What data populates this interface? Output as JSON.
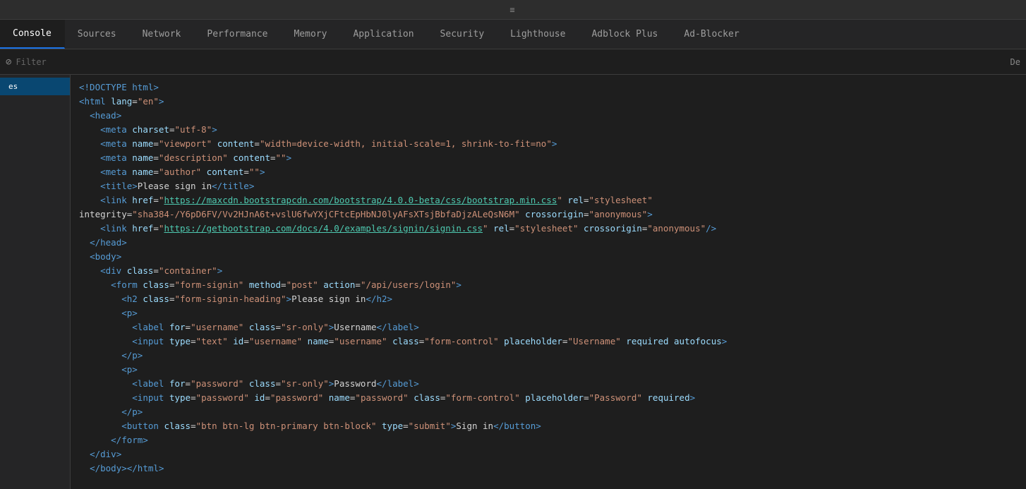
{
  "topBar": {
    "dragHandle": "≡"
  },
  "tabs": [
    {
      "id": "console",
      "label": "Console",
      "active": true
    },
    {
      "id": "sources",
      "label": "Sources",
      "active": false
    },
    {
      "id": "network",
      "label": "Network",
      "active": false
    },
    {
      "id": "performance",
      "label": "Performance",
      "active": false
    },
    {
      "id": "memory",
      "label": "Memory",
      "active": false
    },
    {
      "id": "application",
      "label": "Application",
      "active": false
    },
    {
      "id": "security",
      "label": "Security",
      "active": false
    },
    {
      "id": "lighthouse",
      "label": "Lighthouse",
      "active": false
    },
    {
      "id": "adblock-plus",
      "label": "Adblock Plus",
      "active": false
    },
    {
      "id": "ad-blocker",
      "label": "Ad-Blocker",
      "active": false
    }
  ],
  "filterBar": {
    "placeholder": "Filter",
    "rightLabel": "De"
  },
  "sidebar": {
    "items": [
      {
        "label": "es",
        "active": true
      }
    ]
  },
  "codeLines": [
    {
      "indent": 0,
      "html": "&lt;!DOCTYPE html&gt;"
    },
    {
      "indent": 0,
      "html": "&lt;html lang=\"en\"&gt;"
    },
    {
      "indent": 1,
      "html": "  &lt;head&gt;"
    },
    {
      "indent": 2,
      "html": "    &lt;meta charset=\"utf-8\"&gt;"
    },
    {
      "indent": 2,
      "html": "    &lt;meta name=\"viewport\" content=\"width=device-width, initial-scale=1, shrink-to-fit=no\"&gt;"
    },
    {
      "indent": 2,
      "html": "    &lt;meta name=\"description\" content=\"\"&gt;"
    },
    {
      "indent": 2,
      "html": "    &lt;meta name=\"author\" content=\"\"&gt;"
    },
    {
      "indent": 2,
      "html": "    &lt;title&gt;Please sign in&lt;/title&gt;"
    },
    {
      "indent": 2,
      "html": "    &lt;link href=\"<a>https://maxcdn.bootstrapcdn.com/bootstrap/4.0.0-beta/css/bootstrap.min.css</a>\" rel=\"stylesheet\""
    },
    {
      "indent": 0,
      "html": "integrity=\"sha384-/Y6pD6FV/Vv2HJnA6t+vslU6fwYXjCFtcEpHbNJ0lyAFsXTsjBbfaDjzALeQsN6M\" crossorigin=\"anonymous\"&gt;"
    },
    {
      "indent": 2,
      "html": "    &lt;link href=\"<a>https://getbootstrap.com/docs/4.0/examples/signin/signin.css</a>\" rel=\"stylesheet\" crossorigin=\"anonymous\"/&gt;"
    },
    {
      "indent": 1,
      "html": "  &lt;/head&gt;"
    },
    {
      "indent": 1,
      "html": "  &lt;body&gt;"
    },
    {
      "indent": 2,
      "html": "    &lt;div class=\"container\"&gt;"
    },
    {
      "indent": 3,
      "html": "      &lt;form class=\"form-signin\" method=\"post\" action=\"/api/users/login\"&gt;"
    },
    {
      "indent": 4,
      "html": "        &lt;h2 class=\"form-signin-heading\"&gt;Please sign in&lt;/h2&gt;"
    },
    {
      "indent": 4,
      "html": "        &lt;p&gt;"
    },
    {
      "indent": 5,
      "html": "          &lt;label for=\"username\" class=\"sr-only\"&gt;Username&lt;/label&gt;"
    },
    {
      "indent": 5,
      "html": "          &lt;input type=\"text\" id=\"username\" name=\"username\" class=\"form-control\" placeholder=\"Username\" required autofocus&gt;"
    },
    {
      "indent": 4,
      "html": "        &lt;/p&gt;"
    },
    {
      "indent": 4,
      "html": "        &lt;p&gt;"
    },
    {
      "indent": 5,
      "html": "          &lt;label for=\"password\" class=\"sr-only\"&gt;Password&lt;/label&gt;"
    },
    {
      "indent": 5,
      "html": "          &lt;input type=\"password\" id=\"password\" name=\"password\" class=\"form-control\" placeholder=\"Password\" required&gt;"
    },
    {
      "indent": 4,
      "html": "        &lt;/p&gt;"
    },
    {
      "indent": 4,
      "html": "        &lt;button class=\"btn btn-lg btn-primary btn-block\" type=\"submit\"&gt;Sign in&lt;/button&gt;"
    },
    {
      "indent": 3,
      "html": "      &lt;/form&gt;"
    },
    {
      "indent": 1,
      "html": "  &lt;/div&gt;"
    },
    {
      "indent": 0,
      "html": "  &lt;/body&gt;&lt;/html&gt;"
    }
  ]
}
